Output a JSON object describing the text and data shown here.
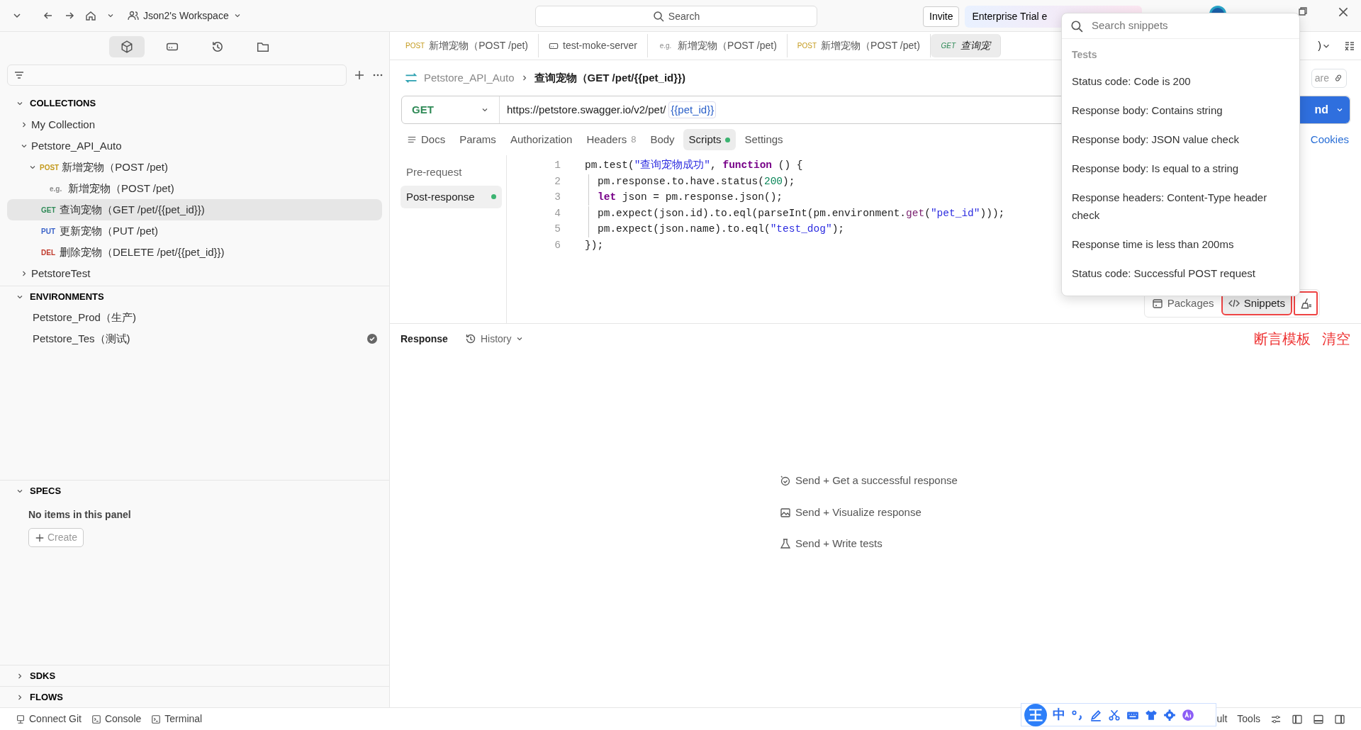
{
  "topbar": {
    "workspace": "Json2's Workspace",
    "search": "Search",
    "invite": "Invite",
    "trial": "Enterprise Trial e"
  },
  "sidebar": {
    "collections_title": "COLLECTIONS",
    "collections": [
      {
        "label": "My Collection",
        "expanded": false,
        "selected": false
      },
      {
        "label": "Petstore_API_Auto",
        "expanded": true,
        "selected": false,
        "children": [
          {
            "method": "POST",
            "color": "#c49a1c",
            "label": "新增宠物（POST /pet)",
            "expanded": true,
            "selected": false,
            "children": [
              {
                "method": "e.g.",
                "color": "#8a8a8a",
                "label": "新增宠物（POST /pet)",
                "selected": false
              }
            ]
          },
          {
            "method": "GET",
            "color": "#2f8a57",
            "label": "查询宠物（GET /pet/{{pet_id}})",
            "selected": true
          },
          {
            "method": "PUT",
            "color": "#3a63c9",
            "label": "更新宠物（PUT /pet)",
            "selected": false
          },
          {
            "method": "DEL",
            "color": "#c0392b",
            "label": "删除宠物（DELETE /pet/{{pet_id}})",
            "selected": false
          }
        ]
      },
      {
        "label": "PetstoreTest",
        "expanded": false,
        "selected": false
      }
    ],
    "environments_title": "ENVIRONMENTS",
    "environments": [
      {
        "label": "Petstore_Prod（生产)",
        "active": false
      },
      {
        "label": "Petstore_Tes（测试)",
        "active": true
      }
    ],
    "specs_title": "SPECS",
    "specs_empty": "No items in this panel",
    "create": "Create",
    "sdks_title": "SDKS",
    "flows_title": "FLOWS"
  },
  "tabs": [
    {
      "kind": "request",
      "method": "POST",
      "color": "#c49a1c",
      "label": "新增宠物（POST /pet)",
      "selected": false
    },
    {
      "kind": "server",
      "label": "test-moke-server",
      "selected": false
    },
    {
      "kind": "request",
      "method": "e.g.",
      "color": "#8a8a8a",
      "label": "新增宠物（POST /pet)",
      "selected": false
    },
    {
      "kind": "request",
      "method": "POST",
      "color": "#c49a1c",
      "label": "新增宠物（POST /pet)",
      "selected": false
    },
    {
      "kind": "request",
      "method": "GET",
      "color": "#2f8a57",
      "label": "查询宠",
      "selected": true
    }
  ],
  "tabs_tail": ")",
  "breadcrumb": {
    "collection": "Petstore_API_Auto",
    "request": "查询宠物（GET /pet/{{pet_id}})",
    "share": "are"
  },
  "request": {
    "method": "GET",
    "url": "https://petstore.swagger.io/v2/pet/",
    "variable": "{{pet_id}}",
    "send": "nd"
  },
  "request_tabs": [
    {
      "label": "Docs",
      "selected": false
    },
    {
      "label": "Params",
      "selected": false
    },
    {
      "label": "Authorization",
      "selected": false
    },
    {
      "label": "Headers",
      "count": "8",
      "selected": false
    },
    {
      "label": "Body",
      "selected": false
    },
    {
      "label": "Scripts",
      "dot": true,
      "selected": true
    },
    {
      "label": "Settings",
      "selected": false
    }
  ],
  "cookies": "Cookies",
  "script_sides": [
    {
      "label": "Pre-request",
      "selected": false,
      "dot": false
    },
    {
      "label": "Post-response",
      "selected": true,
      "dot": true
    }
  ],
  "code": [
    {
      "n": "1",
      "tokens": [
        {
          "kind": "plain",
          "text": "pm.test("
        },
        {
          "kind": "str",
          "text": "\"查询宠物成功\""
        },
        {
          "kind": "plain",
          "text": ", "
        },
        {
          "kind": "kw",
          "text": "function"
        },
        {
          "kind": "plain",
          "text": " () {"
        }
      ]
    },
    {
      "n": "2",
      "indent": true,
      "tokens": [
        {
          "kind": "plain",
          "text": "pm.response.to.have.status("
        },
        {
          "kind": "num",
          "text": "200"
        },
        {
          "kind": "plain",
          "text": ");"
        }
      ]
    },
    {
      "n": "3",
      "indent": true,
      "tokens": [
        {
          "kind": "kw",
          "text": "let"
        },
        {
          "kind": "plain",
          "text": " json = pm.response.json();"
        }
      ]
    },
    {
      "n": "4",
      "indent": true,
      "tokens": [
        {
          "kind": "plain",
          "text": "pm.expect(json.id).to.eql(parseInt(pm.environment."
        },
        {
          "kind": "fn",
          "text": "get"
        },
        {
          "kind": "plain",
          "text": "("
        },
        {
          "kind": "str",
          "text": "\"pet_id\""
        },
        {
          "kind": "plain",
          "text": ")));"
        }
      ]
    },
    {
      "n": "5",
      "indent": true,
      "tokens": [
        {
          "kind": "plain",
          "text": "pm.expect(json.name).to.eql("
        },
        {
          "kind": "str",
          "text": "\"test_dog\""
        },
        {
          "kind": "plain",
          "text": ");"
        }
      ]
    },
    {
      "n": "6",
      "tokens": [
        {
          "kind": "plain",
          "text": "});"
        }
      ]
    }
  ],
  "script_toolbar": {
    "packages": "Packages",
    "snippets": "Snippets",
    "snippets_active": true
  },
  "response": {
    "title": "Response",
    "history": "History",
    "annotations": [
      "断言模板",
      "清空"
    ]
  },
  "empty_state": [
    "Send + Get a successful response",
    "Send + Visualize response",
    "Send + Write tests"
  ],
  "snippets": {
    "placeholder": "Search snippets",
    "section": "Tests",
    "items": [
      "Status code: Code is 200",
      "Response body: Contains string",
      "Response body: JSON value check",
      "Response body: Is equal to a string",
      "Response headers: Content-Type header check",
      "Response time is less than 200ms",
      "Status code: Successful POST request"
    ]
  },
  "status_bar": {
    "left": [
      "Connect Git",
      "Console",
      "Terminal"
    ],
    "right": [
      "ult",
      "Tools"
    ]
  },
  "ime": {
    "logo": "王",
    "mode": "中"
  }
}
